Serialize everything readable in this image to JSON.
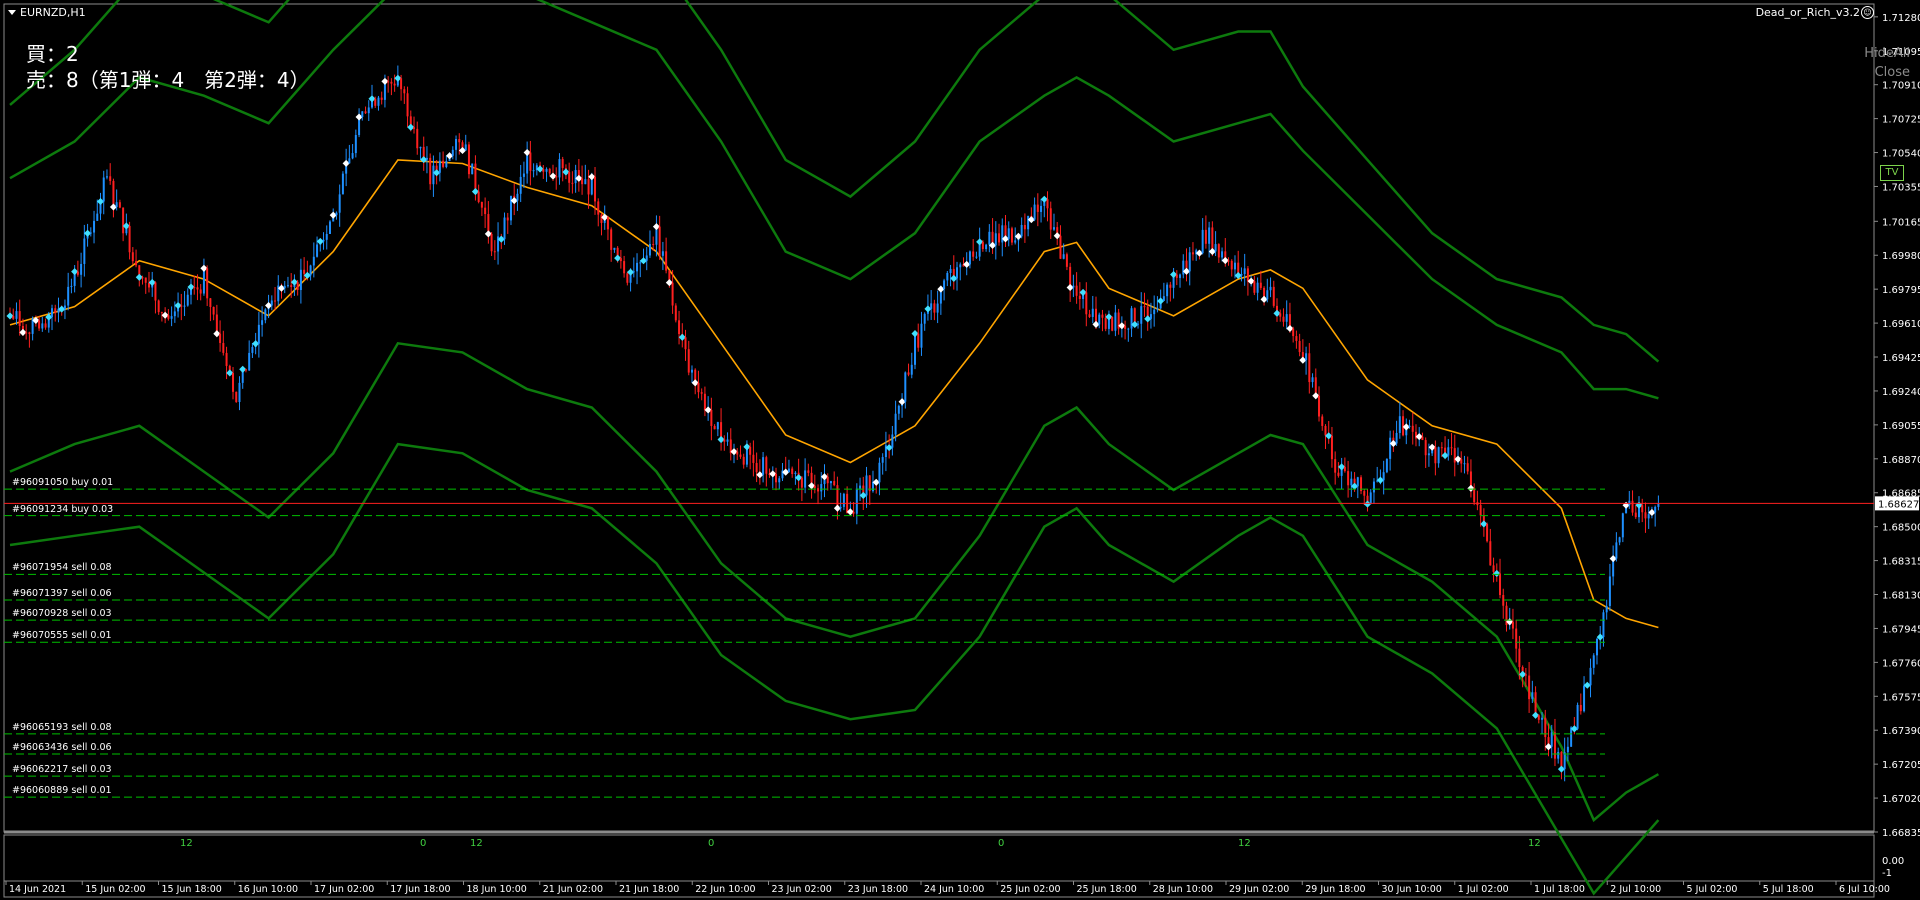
{
  "chart": {
    "symbol": "EURNZD,H1",
    "indicator_name": "Dead_or_Rich_v3.2",
    "buy_counter": "買：2",
    "sell_counter": "売：8（第1弾：4　第2弾：4）",
    "hide_all_label": "HideAll",
    "close_label": "Close",
    "tv_label": "TV",
    "current_price": "1.68627",
    "indicator_window_levels": [
      "0.00",
      "-1"
    ],
    "colors": {
      "background": "#000000",
      "bull_candle": "#1e90ff",
      "bear_candle": "#ff2020",
      "band": "#0d7a0d",
      "moving_average": "#ffa500",
      "order_line": "#00c000",
      "current_price_line": "#ff2020"
    }
  },
  "orders": [
    {
      "label": "#96091050 buy 0.01",
      "price": 1.68705
    },
    {
      "label": "#96091234 buy 0.03",
      "price": 1.6856
    },
    {
      "label": "#96071954 sell 0.08",
      "price": 1.6824
    },
    {
      "label": "#96071397 sell 0.06",
      "price": 1.681
    },
    {
      "label": "#96070928 sell 0.03",
      "price": 1.6799
    },
    {
      "label": "#96070555 sell 0.01",
      "price": 1.6787
    },
    {
      "label": "#96065193 sell 0.08",
      "price": 1.6737
    },
    {
      "label": "#96063436 sell 0.06",
      "price": 1.6726
    },
    {
      "label": "#96062217 sell 0.03",
      "price": 1.6714
    },
    {
      "label": "#96060889 sell 0.01",
      "price": 1.67025
    }
  ],
  "chart_data": {
    "type": "candlestick",
    "price_axis_labels": [
      1.7128,
      1.71095,
      1.7091,
      1.70725,
      1.7054,
      1.70355,
      1.70165,
      1.6998,
      1.69795,
      1.6961,
      1.69425,
      1.6924,
      1.69055,
      1.6887,
      1.68685,
      1.685,
      1.68315,
      1.6813,
      1.67945,
      1.6776,
      1.67575,
      1.6739,
      1.67205,
      1.6702,
      1.66835
    ],
    "ylim": [
      1.66835,
      1.7135
    ],
    "time_axis_labels": [
      "14 Jun 2021",
      "15 Jun 02:00",
      "15 Jun 18:00",
      "16 Jun 10:00",
      "17 Jun 02:00",
      "17 Jun 18:00",
      "18 Jun 10:00",
      "21 Jun 02:00",
      "21 Jun 18:00",
      "22 Jun 10:00",
      "23 Jun 02:00",
      "23 Jun 18:00",
      "24 Jun 10:00",
      "25 Jun 02:00",
      "25 Jun 18:00",
      "28 Jun 10:00",
      "29 Jun 02:00",
      "29 Jun 18:00",
      "30 Jun 10:00",
      "1 Jul 02:00",
      "1 Jul 18:00",
      "2 Jul 10:00",
      "5 Jul 02:00",
      "5 Jul 18:00",
      "6 Jul 10:00"
    ],
    "hour_markers": [
      "12",
      "0",
      "12",
      "0",
      "0",
      "12",
      "12"
    ],
    "close_path": [
      [
        0,
        1.6965
      ],
      [
        10,
        1.6955
      ],
      [
        20,
        1.6985
      ],
      [
        30,
        1.704
      ],
      [
        40,
        1.699
      ],
      [
        50,
        1.696
      ],
      [
        60,
        1.6985
      ],
      [
        70,
        1.692
      ],
      [
        80,
        1.6975
      ],
      [
        90,
        1.6985
      ],
      [
        100,
        1.702
      ],
      [
        110,
        1.708
      ],
      [
        120,
        1.7095
      ],
      [
        130,
        1.704
      ],
      [
        140,
        1.706
      ],
      [
        150,
        1.7
      ],
      [
        160,
        1.705
      ],
      [
        170,
        1.7045
      ],
      [
        180,
        1.7035
      ],
      [
        190,
        1.6985
      ],
      [
        200,
        1.701
      ],
      [
        210,
        1.6935
      ],
      [
        220,
        1.69
      ],
      [
        230,
        1.6885
      ],
      [
        240,
        1.6878
      ],
      [
        250,
        1.6875
      ],
      [
        260,
        1.686
      ],
      [
        270,
        1.6885
      ],
      [
        280,
        1.695
      ],
      [
        290,
        1.6985
      ],
      [
        300,
        1.7005
      ],
      [
        310,
        1.701
      ],
      [
        320,
        1.7025
      ],
      [
        330,
        1.6975
      ],
      [
        340,
        1.696
      ],
      [
        350,
        1.6965
      ],
      [
        360,
        1.6985
      ],
      [
        370,
        1.701
      ],
      [
        380,
        1.699
      ],
      [
        390,
        1.6975
      ],
      [
        400,
        1.6945
      ],
      [
        410,
        1.6885
      ],
      [
        420,
        1.6865
      ],
      [
        430,
        1.6905
      ],
      [
        440,
        1.689
      ],
      [
        450,
        1.689
      ],
      [
        460,
        1.682
      ],
      [
        470,
        1.676
      ],
      [
        480,
        1.672
      ],
      [
        490,
        1.6775
      ],
      [
        500,
        1.6862
      ],
      [
        510,
        1.6858
      ]
    ],
    "moving_average_path": [
      [
        0,
        1.696
      ],
      [
        20,
        1.697
      ],
      [
        40,
        1.6995
      ],
      [
        60,
        1.6985
      ],
      [
        80,
        1.6965
      ],
      [
        100,
        1.7
      ],
      [
        120,
        1.705
      ],
      [
        140,
        1.7048
      ],
      [
        160,
        1.7035
      ],
      [
        180,
        1.7025
      ],
      [
        200,
        1.7
      ],
      [
        220,
        1.695
      ],
      [
        240,
        1.69
      ],
      [
        260,
        1.6885
      ],
      [
        280,
        1.6905
      ],
      [
        300,
        1.695
      ],
      [
        320,
        1.7
      ],
      [
        330,
        1.7005
      ],
      [
        340,
        1.698
      ],
      [
        360,
        1.6965
      ],
      [
        380,
        1.6985
      ],
      [
        390,
        1.699
      ],
      [
        400,
        1.698
      ],
      [
        420,
        1.693
      ],
      [
        440,
        1.6905
      ],
      [
        460,
        1.6895
      ],
      [
        480,
        1.686
      ],
      [
        490,
        1.681
      ],
      [
        500,
        1.68
      ],
      [
        510,
        1.6795
      ]
    ],
    "upper_band_path": [
      [
        0,
        1.704
      ],
      [
        20,
        1.706
      ],
      [
        40,
        1.7095
      ],
      [
        60,
        1.7085
      ],
      [
        80,
        1.707
      ],
      [
        100,
        1.711
      ],
      [
        120,
        1.7145
      ],
      [
        140,
        1.715
      ],
      [
        160,
        1.714
      ],
      [
        180,
        1.7125
      ],
      [
        200,
        1.711
      ],
      [
        220,
        1.706
      ],
      [
        240,
        1.7
      ],
      [
        260,
        1.6985
      ],
      [
        280,
        1.701
      ],
      [
        300,
        1.706
      ],
      [
        320,
        1.7085
      ],
      [
        330,
        1.7095
      ],
      [
        340,
        1.7085
      ],
      [
        360,
        1.706
      ],
      [
        380,
        1.707
      ],
      [
        390,
        1.7075
      ],
      [
        400,
        1.7055
      ],
      [
        420,
        1.702
      ],
      [
        440,
        1.6985
      ],
      [
        460,
        1.696
      ],
      [
        480,
        1.6945
      ],
      [
        490,
        1.6925
      ],
      [
        500,
        1.6925
      ],
      [
        510,
        1.692
      ]
    ],
    "lower_band_path": [
      [
        0,
        1.688
      ],
      [
        20,
        1.6895
      ],
      [
        40,
        1.6905
      ],
      [
        60,
        1.688
      ],
      [
        80,
        1.6855
      ],
      [
        100,
        1.689
      ],
      [
        120,
        1.695
      ],
      [
        140,
        1.6945
      ],
      [
        160,
        1.6925
      ],
      [
        180,
        1.6915
      ],
      [
        200,
        1.688
      ],
      [
        220,
        1.683
      ],
      [
        240,
        1.68
      ],
      [
        260,
        1.679
      ],
      [
        280,
        1.68
      ],
      [
        300,
        1.6845
      ],
      [
        320,
        1.6905
      ],
      [
        330,
        1.6915
      ],
      [
        340,
        1.6895
      ],
      [
        360,
        1.687
      ],
      [
        380,
        1.689
      ],
      [
        390,
        1.69
      ],
      [
        400,
        1.6895
      ],
      [
        420,
        1.684
      ],
      [
        440,
        1.682
      ],
      [
        460,
        1.679
      ],
      [
        480,
        1.673
      ],
      [
        490,
        1.669
      ],
      [
        500,
        1.6705
      ],
      [
        510,
        1.6715
      ]
    ],
    "outer_upper_band_path": [
      [
        0,
        1.708
      ],
      [
        20,
        1.711
      ],
      [
        40,
        1.715
      ],
      [
        60,
        1.714
      ],
      [
        80,
        1.7125
      ],
      [
        100,
        1.7165
      ],
      [
        120,
        1.72
      ],
      [
        140,
        1.721
      ],
      [
        160,
        1.72
      ],
      [
        180,
        1.718
      ],
      [
        200,
        1.716
      ],
      [
        220,
        1.711
      ],
      [
        240,
        1.705
      ],
      [
        260,
        1.703
      ],
      [
        280,
        1.706
      ],
      [
        300,
        1.711
      ],
      [
        320,
        1.714
      ],
      [
        330,
        1.715
      ],
      [
        340,
        1.714
      ],
      [
        360,
        1.711
      ],
      [
        380,
        1.712
      ],
      [
        390,
        1.712
      ],
      [
        400,
        1.709
      ],
      [
        420,
        1.705
      ],
      [
        440,
        1.701
      ],
      [
        460,
        1.6985
      ],
      [
        480,
        1.6975
      ],
      [
        490,
        1.696
      ],
      [
        500,
        1.6955
      ],
      [
        510,
        1.694
      ]
    ],
    "outer_lower_band_path": [
      [
        0,
        1.684
      ],
      [
        20,
        1.6845
      ],
      [
        40,
        1.685
      ],
      [
        60,
        1.6825
      ],
      [
        80,
        1.68
      ],
      [
        100,
        1.6835
      ],
      [
        120,
        1.6895
      ],
      [
        140,
        1.689
      ],
      [
        160,
        1.687
      ],
      [
        180,
        1.686
      ],
      [
        200,
        1.683
      ],
      [
        220,
        1.678
      ],
      [
        240,
        1.6755
      ],
      [
        260,
        1.6745
      ],
      [
        280,
        1.675
      ],
      [
        300,
        1.679
      ],
      [
        320,
        1.685
      ],
      [
        330,
        1.686
      ],
      [
        340,
        1.684
      ],
      [
        360,
        1.682
      ],
      [
        380,
        1.6845
      ],
      [
        390,
        1.6855
      ],
      [
        400,
        1.6845
      ],
      [
        420,
        1.679
      ],
      [
        440,
        1.677
      ],
      [
        460,
        1.674
      ],
      [
        480,
        1.668
      ],
      [
        490,
        1.665
      ],
      [
        500,
        1.667
      ],
      [
        510,
        1.669
      ]
    ]
  }
}
